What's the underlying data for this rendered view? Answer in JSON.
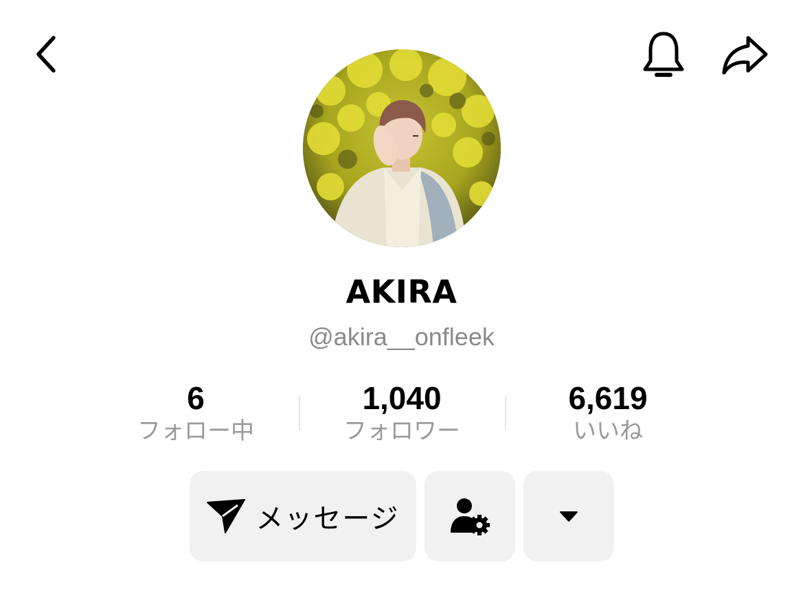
{
  "header": {
    "back_icon": "chevron-left-icon",
    "bell_icon": "bell-icon",
    "share_icon": "share-arrow-icon"
  },
  "profile": {
    "display_name": "AKIRA",
    "username": "@akira__onfleek"
  },
  "stats": [
    {
      "value": "6",
      "label": "フォロー中"
    },
    {
      "value": "1,040",
      "label": "フォロワー"
    },
    {
      "value": "6,619",
      "label": "いいね"
    }
  ],
  "actions": {
    "message_label": "メッセージ",
    "message_icon": "send-icon",
    "follow_settings_icon": "user-gear-icon",
    "more_icon": "caret-down-icon"
  },
  "colors": {
    "button_bg": "#f1f1f1",
    "secondary_text": "#8a8a8a",
    "divider": "#e6e6e6"
  }
}
